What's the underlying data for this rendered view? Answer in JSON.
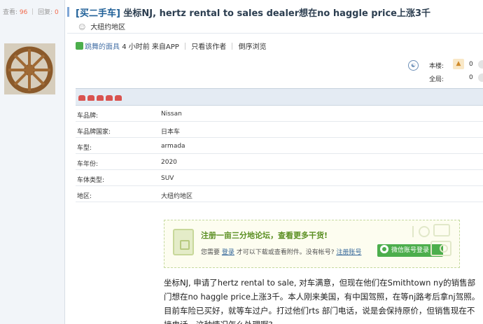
{
  "stats": {
    "views_label": "查看:",
    "views": "96",
    "replies_label": "回复:",
    "replies": "0"
  },
  "thread": {
    "tag": "[买二手车]",
    "title": "坐标NJ, hertz rental to sales dealer想在no haggle price上涨3千",
    "region": "大纽约地区"
  },
  "author_row": {
    "author": "跳舞的面具",
    "time": "4 小时前",
    "via": "来自APP",
    "only_author": "只看该作者",
    "reverse": "倒序浏览"
  },
  "vote": {
    "floor_label": "本楼:",
    "floor_count": "0",
    "all_label": "全局:",
    "all_count": "0"
  },
  "specs": [
    {
      "key": "车品牌:",
      "value": "Nissan"
    },
    {
      "key": "车品牌国家:",
      "value": "日本车"
    },
    {
      "key": "车型:",
      "value": "armada"
    },
    {
      "key": "车年份:",
      "value": "2020"
    },
    {
      "key": "车体类型:",
      "value": "SUV"
    },
    {
      "key": "地区:",
      "value": "大纽约地区"
    }
  ],
  "login_box": {
    "title": "注册一亩三分地论坛，查看更多干货!",
    "prefix": "您需要",
    "login_link": "登录",
    "middle": "才可以下载或查看附件。没有帐号?",
    "register_link": "注册账号",
    "wechat_button": "微信账号登录"
  },
  "post_body": "坐标NJ, 申请了hertz rental to sale, 对车满意，但现在他们在Smithtown ny的销售部门想在no haggle price上涨3千。本人刚来美国，有中国驾照，在等nj路考后拿nj驾照。目前车险已买好，就等车过户。打过他们rts 部门电话，说是会保持原价，但销售现在不接电话，这种情况怎么处理啊?",
  "colors": {
    "accent_green": "#4cae4c",
    "link_blue": "#336699",
    "header_bg": "#e4ebf3"
  }
}
